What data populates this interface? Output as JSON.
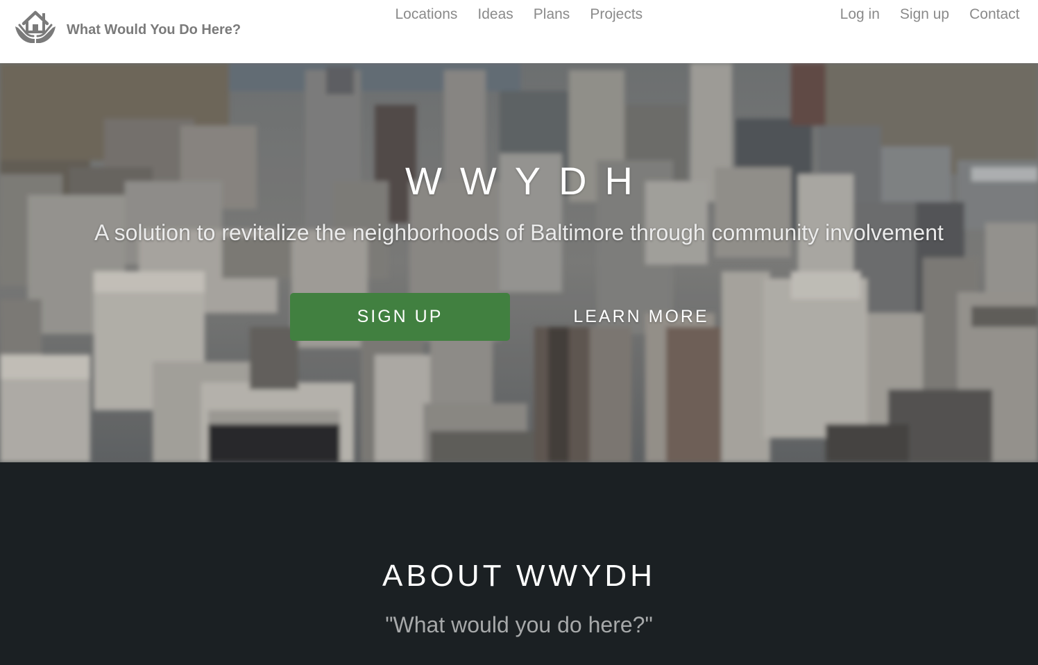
{
  "brand": {
    "name": "What Would You Do Here?",
    "logo_icon": "house-in-hands-icon",
    "logo_color": "#7a7a7a"
  },
  "nav": {
    "center": [
      {
        "label": "Locations"
      },
      {
        "label": "Ideas"
      },
      {
        "label": "Plans"
      },
      {
        "label": "Projects"
      }
    ],
    "right": [
      {
        "label": "Log in"
      },
      {
        "label": "Sign up"
      },
      {
        "label": "Contact"
      }
    ]
  },
  "hero": {
    "title": "WWYDH",
    "subtitle": "A solution to revitalize the neighborhoods of Baltimore through community involvement",
    "background": "blurred-aerial-city-photo",
    "signup_label": "SIGN UP",
    "learn_more_label": "LEARN MORE",
    "signup_color": "#418040"
  },
  "about": {
    "title": "ABOUT WWYDH",
    "quote": "\"What would you do here?\"",
    "background_color": "#1b2023"
  }
}
